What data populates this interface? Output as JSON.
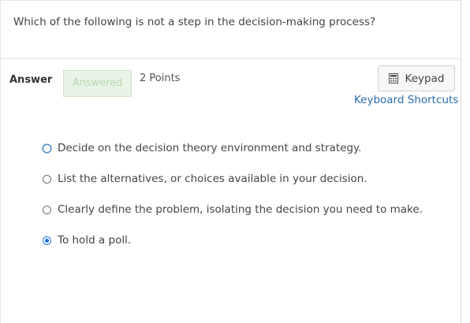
{
  "question": {
    "text": "Which of the following is not a step in the decision-making process?"
  },
  "answer": {
    "label": "Answer",
    "status_badge": "Answered",
    "points": "2 Points",
    "keypad_label": "Keypad",
    "keyboard_shortcuts": "Keyboard Shortcuts"
  },
  "options": [
    {
      "label": "Decide on the decision theory environment and strategy.",
      "checked": false
    },
    {
      "label": "List the alternatives, or choices available in your decision.",
      "checked": false
    },
    {
      "label": "Clearly define the problem, isolating the decision you need to make.",
      "checked": false
    },
    {
      "label": "To hold a poll.",
      "checked": true
    }
  ],
  "colors": {
    "accent": "#1a73e8",
    "link": "#2a6fb0",
    "answered_bg": "#e9f4e6",
    "answered_text": "#b9d8b0"
  },
  "icons": {
    "keypad": "calculator-icon"
  }
}
